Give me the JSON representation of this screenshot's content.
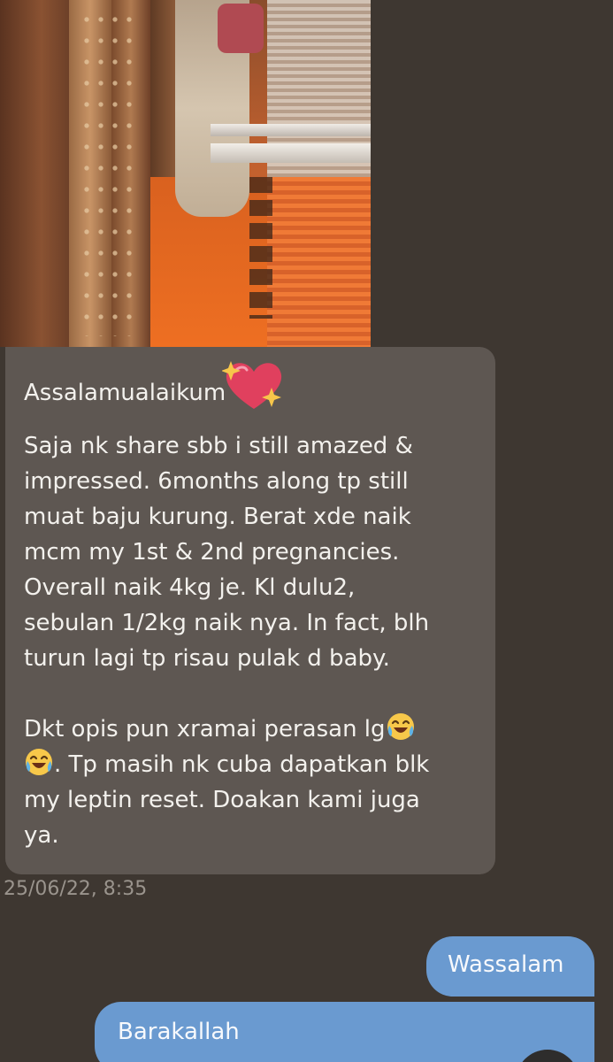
{
  "photo": {
    "icon": "photo-attachment-elevator"
  },
  "incoming": {
    "greeting": "Assalamualaikum",
    "greeting_emoji": "sparkling-heart-icon",
    "paragraph1": [
      "Saja nk share sbb i still amazed &",
      "impressed. 6months along tp still",
      "muat baju kurung. Berat xde naik",
      "mcm my 1st & 2nd pregnancies.",
      "Overall naik 4kg je. Kl dulu2,",
      "sebulan 1/2kg naik nya. In fact, blh",
      "turun lagi tp risau pulak d baby."
    ],
    "paragraph2": {
      "line1": "Dkt opis pun xramai perasan lg",
      "line2": ". Tp masih nk cuba dapatkan blk",
      "line3": "my leptin reset. Doakan kami juga",
      "line4": "ya.",
      "emoji": "face-with-tears-of-joy-icon"
    },
    "timestamp": "25/06/22, 8:35"
  },
  "outgoing": [
    {
      "text": "Wassalam"
    },
    {
      "text": "Barakallah"
    }
  ],
  "colors": {
    "background": "#3e3731",
    "incoming_bubble": "#5e5752",
    "outgoing_bubble": "#6a9ad0",
    "text_light": "#f3f1ed",
    "timestamp": "#9a948d"
  }
}
